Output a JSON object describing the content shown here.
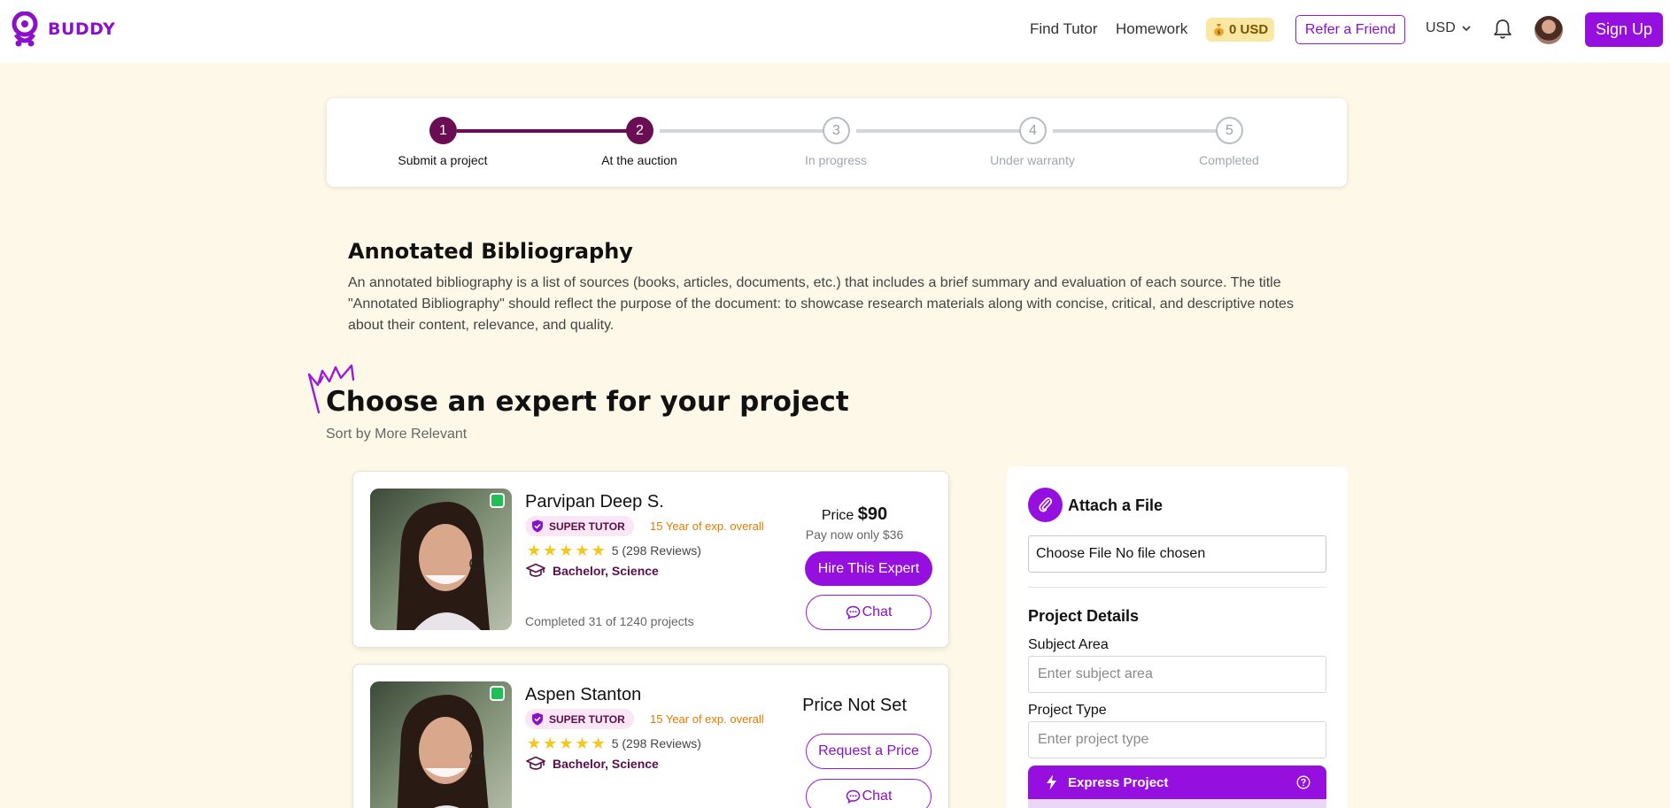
{
  "header": {
    "brand": "BUDDY",
    "nav": [
      {
        "label": "Find Tutor"
      },
      {
        "label": "Homework"
      }
    ],
    "wallet": "0 USD",
    "refer_label": "Refer a Friend",
    "currency": "USD",
    "signup_label": "Sign Up",
    "brand_color": "#8b10c9"
  },
  "stepper": {
    "steps": [
      {
        "number": "1",
        "label": "Submit a project",
        "state": "done"
      },
      {
        "number": "2",
        "label": "At the auction",
        "state": "done"
      },
      {
        "number": "3",
        "label": "In progress",
        "state": "todo"
      },
      {
        "number": "4",
        "label": "Under warranty",
        "state": "todo"
      },
      {
        "number": "5",
        "label": "Completed",
        "state": "todo"
      }
    ],
    "active_color": "#6b0d52"
  },
  "project": {
    "title": "Annotated Bibliography",
    "description": "An annotated bibliography is a list of sources (books, articles, documents, etc.) that includes a brief summary and evaluation of each source. The title \"Annotated Bibliography\" should reflect the purpose of the document: to showcase research materials along with concise, critical, and descriptive notes about their content, relevance, and quality."
  },
  "experts": {
    "heading": "Choose an expert for your project",
    "sort_label": "Sort by More Relevant",
    "cards": [
      {
        "name": "Parvipan Deep S.",
        "badge": "SUPER TUTOR",
        "experience": "15 Year of exp. overall",
        "rating": "5 (298 Reviews)",
        "stars": 5,
        "degree": "Bachelor, Science",
        "completed": "Completed 31 of 1240 projects",
        "price_prefix": "Price",
        "price": "$90",
        "pay_now": "Pay now only $36",
        "primary_action": "Hire This Expert",
        "chat_label": "Chat"
      },
      {
        "name": "Aspen Stanton",
        "badge": "SUPER TUTOR",
        "experience": "15 Year of exp. overall",
        "rating": "5 (298 Reviews)",
        "stars": 5,
        "degree": "Bachelor, Science",
        "price_status": "Price Not Set",
        "secondary_action": "Request a Price",
        "chat_label": "Chat"
      }
    ]
  },
  "side_panel": {
    "attach_title": "Attach a File",
    "file_input_text": "Choose File No file chosen",
    "details_title": "Project Details",
    "subject_label": "Subject Area",
    "subject_placeholder": "Enter subject area",
    "type_label": "Project Type",
    "type_placeholder": "Enter project type",
    "express_label": "Express Project"
  }
}
